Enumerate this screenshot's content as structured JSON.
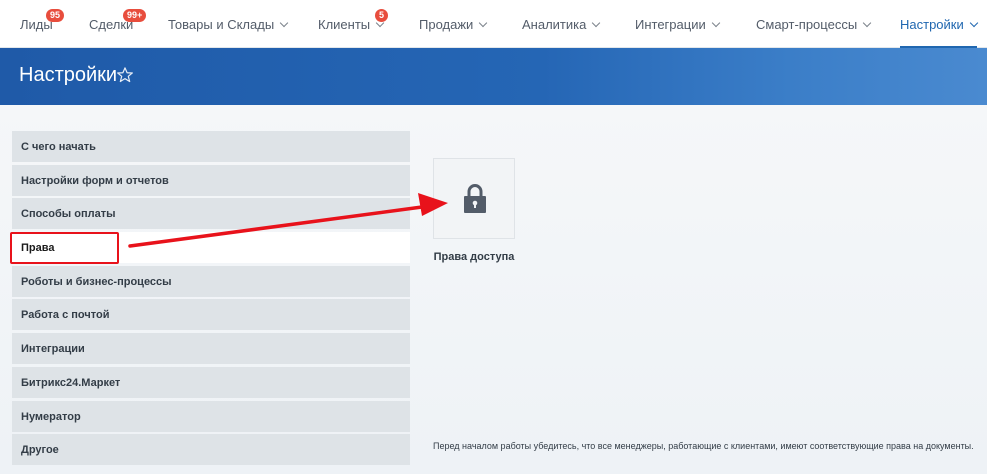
{
  "topnav": {
    "items": [
      {
        "label": "Лиды",
        "badge": "95",
        "has_chevron": false
      },
      {
        "label": "Сделки",
        "badge": "99+",
        "has_chevron": false
      },
      {
        "label": "Товары и Склады",
        "badge": "",
        "has_chevron": true
      },
      {
        "label": "Клиенты",
        "badge": "5",
        "has_chevron": true
      },
      {
        "label": "Продажи",
        "badge": "",
        "has_chevron": true
      },
      {
        "label": "Аналитика",
        "badge": "",
        "has_chevron": true
      },
      {
        "label": "Интеграции",
        "badge": "",
        "has_chevron": true
      },
      {
        "label": "Смарт-процессы",
        "badge": "",
        "has_chevron": true
      },
      {
        "label": "Настройки",
        "badge": "",
        "has_chevron": true,
        "active": true
      }
    ],
    "badge_color": "#e84d3d",
    "active_color": "#2067b0"
  },
  "header": {
    "title": "Настройки",
    "star_icon": "star-outline-icon",
    "color": "#2566b5"
  },
  "menu": {
    "items": [
      {
        "label": "С чего начать"
      },
      {
        "label": "Настройки форм и отчетов"
      },
      {
        "label": "Способы оплаты"
      },
      {
        "label": "Права",
        "active": true
      },
      {
        "label": "Роботы и бизнес-процессы"
      },
      {
        "label": "Работа с почтой"
      },
      {
        "label": "Интеграции"
      },
      {
        "label": "Битрикс24.Маркет"
      },
      {
        "label": "Нумератор"
      },
      {
        "label": "Другое"
      }
    ]
  },
  "tile": {
    "icon": "lock-icon",
    "label": "Права доступа"
  },
  "footer_note": "Перед началом работы убедитесь, что все менеджеры, работающие с клиентами, имеют соответствующие права на документы.",
  "annotation": {
    "color": "#e8121b"
  }
}
